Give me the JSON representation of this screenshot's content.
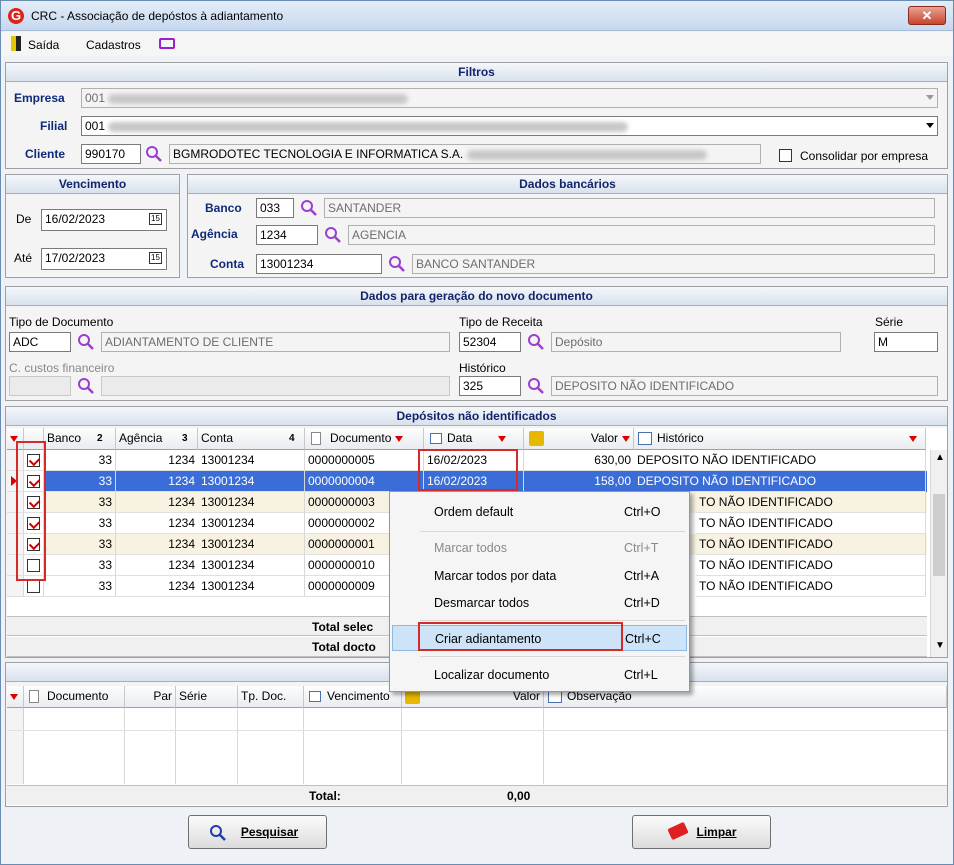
{
  "window": {
    "title": "CRC - Associação de depóstos à adiantamento",
    "close": "✕"
  },
  "menu": {
    "exit_label": "Saída",
    "registers_label": "Cadastros"
  },
  "filters": {
    "header": "Filtros",
    "company_label": "Empresa",
    "company_value": "001",
    "branch_label": "Filial",
    "branch_value": "001",
    "client_label": "Cliente",
    "client_code": "990170",
    "client_name": "BGMRODOTEC TECNOLOGIA E INFORMATICA S.A.",
    "consolidate_label": "Consolidar por empresa"
  },
  "due": {
    "header": "Vencimento",
    "from_label": "De",
    "from_value": "16/02/2023",
    "to_label": "Até",
    "to_value": "17/02/2023",
    "cal_icon": "15"
  },
  "bank": {
    "header": "Dados bancários",
    "bank_label": "Banco",
    "bank_code": "033",
    "bank_name": "SANTANDER",
    "agency_label": "Agência",
    "agency_code": "1234",
    "agency_name": "AGENCIA",
    "account_label": "Conta",
    "account_code": "13001234",
    "account_name": "BANCO SANTANDER"
  },
  "newdoc": {
    "header": "Dados para geração do novo documento",
    "doctype_label": "Tipo de Documento",
    "doctype_code": "ADC",
    "doctype_name": "ADIANTAMENTO DE CLIENTE",
    "revtype_label": "Tipo de Receita",
    "revtype_code": "52304",
    "revtype_name": "Depósito",
    "series_label": "Série",
    "series_value": "M",
    "costcenter_label": "C. custos financeiro",
    "history_label": "Histórico",
    "history_code": "325",
    "history_name": "DEPOSITO NÃO IDENTIFICADO"
  },
  "deposits": {
    "header": "Depósitos não identificados",
    "columns": {
      "banco": "Banco",
      "banco_sort": "2",
      "agencia": "Agência",
      "agencia_sort": "3",
      "conta": "Conta",
      "conta_sort": "4",
      "documento": "Documento",
      "data": "Data",
      "valor": "Valor",
      "historico": "Histórico"
    },
    "rows": [
      {
        "checked": true,
        "banco": "33",
        "agencia": "1234",
        "conta": "13001234",
        "documento": "0000000005",
        "data": "16/02/2023",
        "valor": "630,00",
        "historico": "DEPOSITO NÃO IDENTIFICADO"
      },
      {
        "checked": true,
        "banco": "33",
        "agencia": "1234",
        "conta": "13001234",
        "documento": "0000000004",
        "data": "16/02/2023",
        "valor": "158,00",
        "historico": "DEPOSITO NÃO IDENTIFICADO"
      },
      {
        "checked": true,
        "banco": "33",
        "agencia": "1234",
        "conta": "13001234",
        "documento": "0000000003",
        "data": "",
        "valor": "",
        "historico": "TO NÃO IDENTIFICADO"
      },
      {
        "checked": true,
        "banco": "33",
        "agencia": "1234",
        "conta": "13001234",
        "documento": "0000000002",
        "data": "",
        "valor": "",
        "historico": "TO NÃO IDENTIFICADO"
      },
      {
        "checked": true,
        "banco": "33",
        "agencia": "1234",
        "conta": "13001234",
        "documento": "0000000001",
        "data": "",
        "valor": "",
        "historico": "TO NÃO IDENTIFICADO"
      },
      {
        "checked": false,
        "banco": "33",
        "agencia": "1234",
        "conta": "13001234",
        "documento": "0000000010",
        "data": "",
        "valor": "",
        "historico": "TO NÃO IDENTIFICADO"
      },
      {
        "checked": false,
        "banco": "33",
        "agencia": "1234",
        "conta": "13001234",
        "documento": "0000000009",
        "data": "",
        "valor": "",
        "historico": "TO NÃO IDENTIFICADO"
      }
    ],
    "total_selected": "Total selec",
    "total_docs": "Total docto"
  },
  "lower_grid": {
    "columns": {
      "documento": "Documento",
      "par": "Par",
      "serie": "Série",
      "tpdoc": "Tp. Doc.",
      "vencimento": "Vencimento",
      "valor": "Valor",
      "observacao": "Observação"
    },
    "total_label": "Total:",
    "total_value": "0,00"
  },
  "context_menu": {
    "items": [
      {
        "label": "Ordem default",
        "shortcut": "Ctrl+O",
        "enabled": true
      },
      {
        "label": "Marcar todos",
        "shortcut": "Ctrl+T",
        "enabled": false
      },
      {
        "label": "Marcar todos por data",
        "shortcut": "Ctrl+A",
        "enabled": true
      },
      {
        "label": "Desmarcar todos",
        "shortcut": "Ctrl+D",
        "enabled": true
      },
      {
        "label": "Criar adiantamento",
        "shortcut": "Ctrl+C",
        "enabled": true
      },
      {
        "label": "Localizar documento",
        "shortcut": "Ctrl+L",
        "enabled": true
      }
    ]
  },
  "buttons": {
    "search": "Pesquisar",
    "clear": "Limpar"
  },
  "colors": {
    "accent": "#12246b",
    "selection": "#3b6dd8",
    "highlight": "#d62a2a"
  }
}
